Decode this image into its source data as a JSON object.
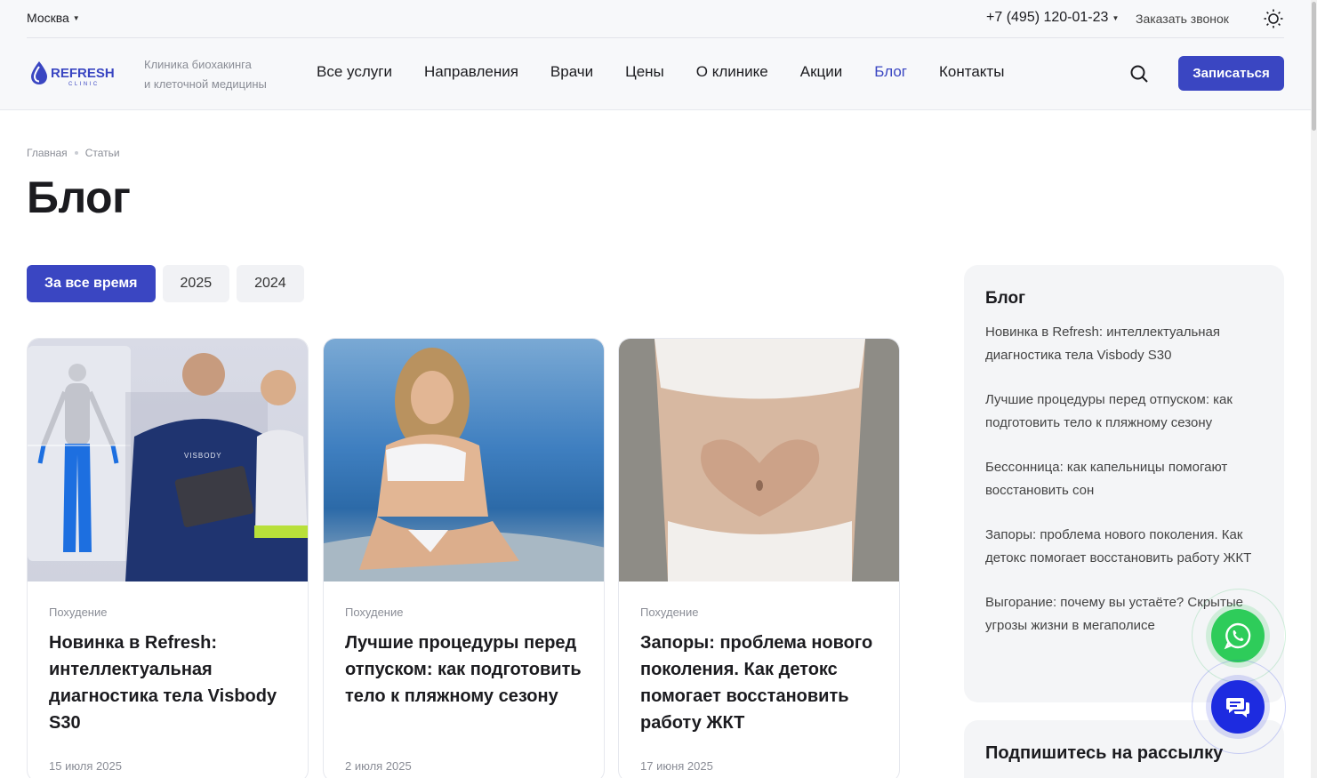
{
  "topbar": {
    "city": "Москва",
    "phone": "+7 (495) 120-01-23",
    "callback": "Заказать звонок"
  },
  "header": {
    "logo_text": "REFRESH",
    "logo_sub": "CLINIC",
    "tagline_1": "Клиника биохакинга",
    "tagline_2": "и клеточной медицины",
    "nav": [
      "Все услуги",
      "Направления",
      "Врачи",
      "Цены",
      "О клинике",
      "Акции",
      "Блог",
      "Контакты"
    ],
    "active_nav": "Блог",
    "book_button": "Записаться"
  },
  "breadcrumb": [
    "Главная",
    "Статьи"
  ],
  "page_title": "Блог",
  "filters": [
    "За все время",
    "2025",
    "2024"
  ],
  "active_filter": "За все время",
  "cards": [
    {
      "category": "Похудение",
      "title": "Новинка в Refresh: интеллектуальная диагностика тела Visbody S30",
      "date": "15 июля 2025",
      "image_text": "VISBODY"
    },
    {
      "category": "Похудение",
      "title": "Лучшие процедуры перед отпуском: как подготовить тело к пляжному сезону",
      "date": "2 июля 2025"
    },
    {
      "category": "Похудение",
      "title": "Запоры: проблема нового поколения. Как детокс помогает восстановить работу ЖКТ",
      "date": "17 июня 2025"
    }
  ],
  "sidebar": {
    "title": "Блог",
    "items": [
      "Новинка в Refresh: интеллектуальная диагностика тела Visbody S30",
      "Лучшие процедуры перед отпуском: как подготовить тело к пляжному сезону",
      "Бессонница: как капельницы помогают восстановить сон",
      "Запоры: проблема нового поколения. Как детокс помогает восстановить работу ЖКТ",
      "Выгорание: почему вы устаёте? Скрытые угрозы жизни в мегаполисе"
    ],
    "subscribe_title": "Подпишитесь на рассылку"
  },
  "colors": {
    "accent": "#3a46c2",
    "whatsapp": "#2ecc5a",
    "chat": "#1d2be0"
  },
  "icons": [
    "chevron-down-icon",
    "sun-icon",
    "search-icon",
    "whatsapp-icon",
    "chat-icon"
  ]
}
